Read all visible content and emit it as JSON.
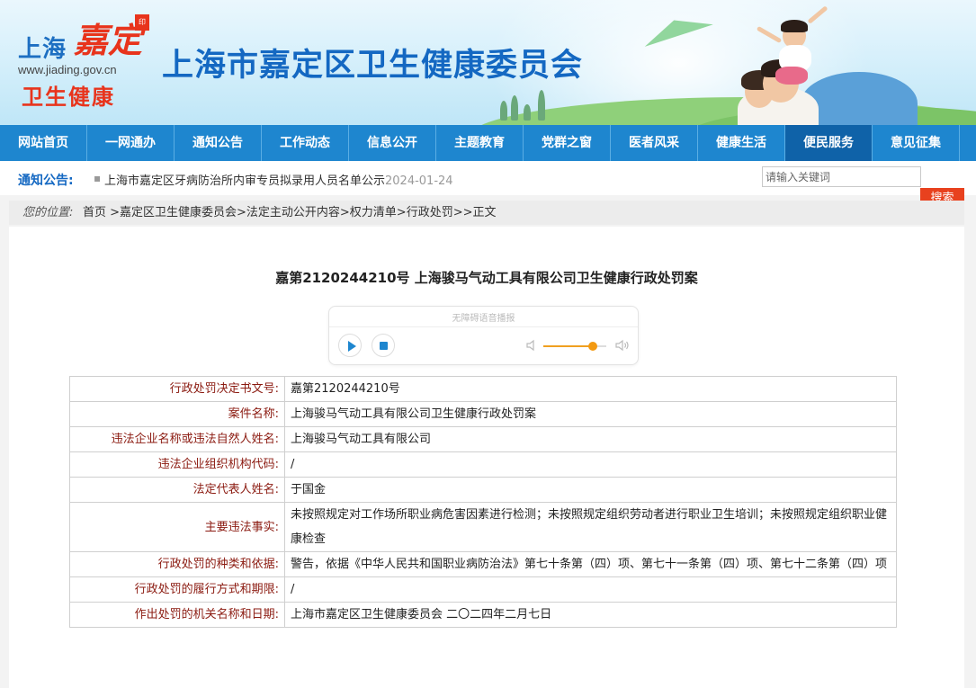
{
  "header": {
    "logo_city": "上海",
    "logo_district": "嘉定",
    "logo_url": "www.jiading.gov.cn",
    "logo_bureau": "卫生健康",
    "site_title": "上海市嘉定区卫生健康委员会"
  },
  "nav": {
    "items": [
      {
        "label": "网站首页"
      },
      {
        "label": "一网通办"
      },
      {
        "label": "通知公告"
      },
      {
        "label": "工作动态"
      },
      {
        "label": "信息公开"
      },
      {
        "label": "主题教育"
      },
      {
        "label": "党群之窗"
      },
      {
        "label": "医者风采"
      },
      {
        "label": "健康生活"
      },
      {
        "label": "便民服务"
      },
      {
        "label": "意见征集"
      }
    ],
    "active_index": 9
  },
  "notice": {
    "label": "通知公告:",
    "text": "上海市嘉定区牙病防治所内审专员拟录用人员名单公示",
    "date": "2024-01-24"
  },
  "search": {
    "placeholder": "请输入关键词",
    "button_label": "搜索"
  },
  "breadcrumb": {
    "label": "您的位置:",
    "path": "首页 >嘉定区卫生健康委员会>法定主动公开内容>权力清单>行政处罚>>正文"
  },
  "article": {
    "title": "嘉第2120244210号  上海骏马气动工具有限公司卫生健康行政处罚案"
  },
  "player": {
    "label": "无障碍语音播报",
    "volume_fraction": 0.78
  },
  "table": {
    "rows": [
      {
        "key": "行政处罚决定书文号:",
        "value": "嘉第2120244210号"
      },
      {
        "key": "案件名称:",
        "value": "上海骏马气动工具有限公司卫生健康行政处罚案"
      },
      {
        "key": "违法企业名称或违法自然人姓名:",
        "value": "上海骏马气动工具有限公司"
      },
      {
        "key": "违法企业组织机构代码:",
        "value": "/"
      },
      {
        "key": "法定代表人姓名:",
        "value": "于国金"
      },
      {
        "key": "主要违法事实:",
        "value": "未按照规定对工作场所职业病危害因素进行检测；未按照规定组织劳动者进行职业卫生培训；未按照规定组织职业健康检查"
      },
      {
        "key": "行政处罚的种类和依据:",
        "value": "警告，依据《中华人民共和国职业病防治法》第七十条第（四）项、第七十一条第（四）项、第七十二条第（四）项"
      },
      {
        "key": "行政处罚的履行方式和期限:",
        "value": "/"
      },
      {
        "key": "作出处罚的机关名称和日期:",
        "value": "上海市嘉定区卫生健康委员会 二〇二四年二月七日"
      }
    ]
  },
  "colors": {
    "nav_bg": "#1e86cf",
    "nav_active": "#0f62a8",
    "title_blue": "#1468c2",
    "brand_red": "#e8341c",
    "search_button": "#e8411e",
    "table_key_text": "#8b1a10"
  }
}
